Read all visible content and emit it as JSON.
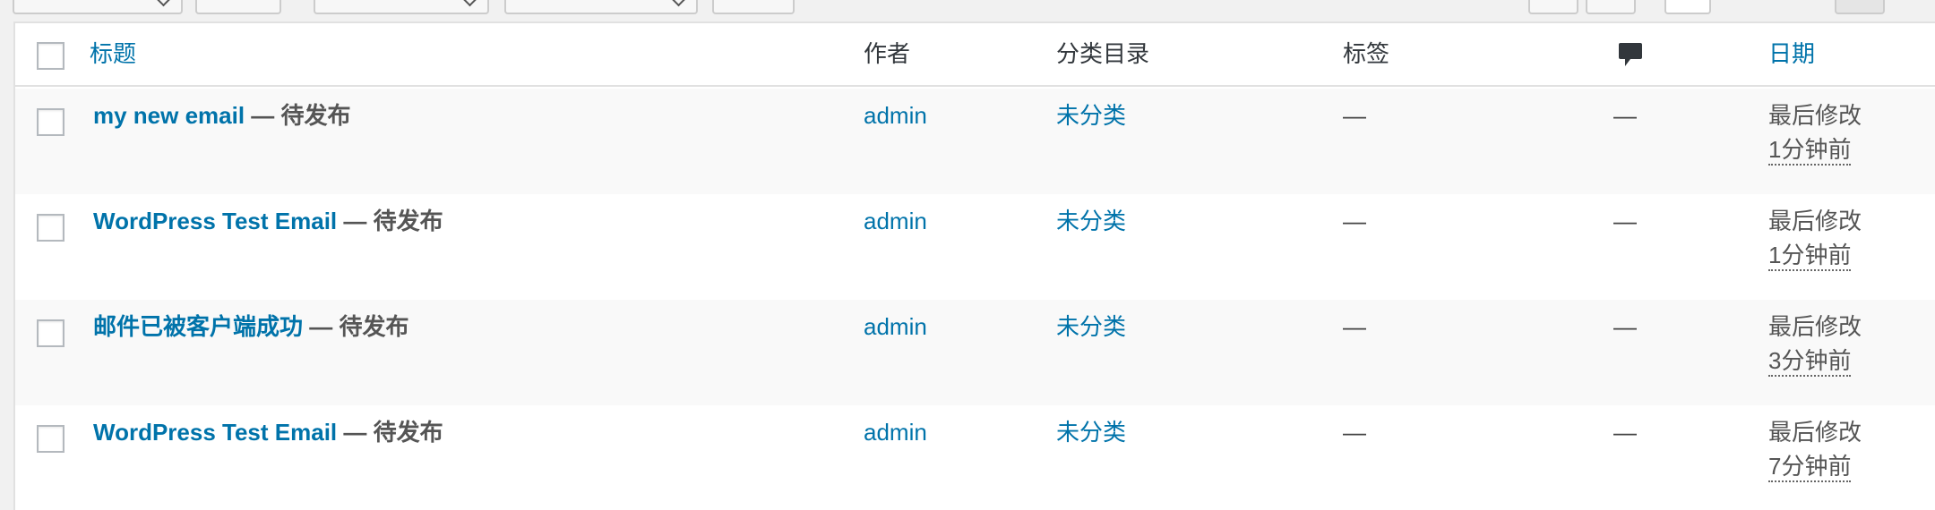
{
  "header": {
    "col_title": "标题",
    "col_author": "作者",
    "col_category": "分类目录",
    "col_tags": "标签",
    "col_comments_icon": "comment-bubble-icon",
    "col_date": "日期"
  },
  "rows": [
    {
      "title": "my new email",
      "state": " — 待发布",
      "author": "admin",
      "category": "未分类",
      "tags": "—",
      "comments": "—",
      "date_label": "最后修改",
      "date_value": "1分钟前"
    },
    {
      "title": "WordPress Test Email",
      "state": " — 待发布",
      "author": "admin",
      "category": "未分类",
      "tags": "—",
      "comments": "—",
      "date_label": "最后修改",
      "date_value": "1分钟前"
    },
    {
      "title": "邮件已被客户端成功",
      "state": " — 待发布",
      "author": "admin",
      "category": "未分类",
      "tags": "—",
      "comments": "—",
      "date_label": "最后修改",
      "date_value": "3分钟前"
    },
    {
      "title": "WordPress Test Email",
      "state": " — 待发布",
      "author": "admin",
      "category": "未分类",
      "tags": "—",
      "comments": "—",
      "date_label": "最后修改",
      "date_value": "7分钟前"
    }
  ],
  "colors": {
    "link": "#0073aa",
    "text": "#32373c",
    "row_alt": "#f9f9f9"
  }
}
